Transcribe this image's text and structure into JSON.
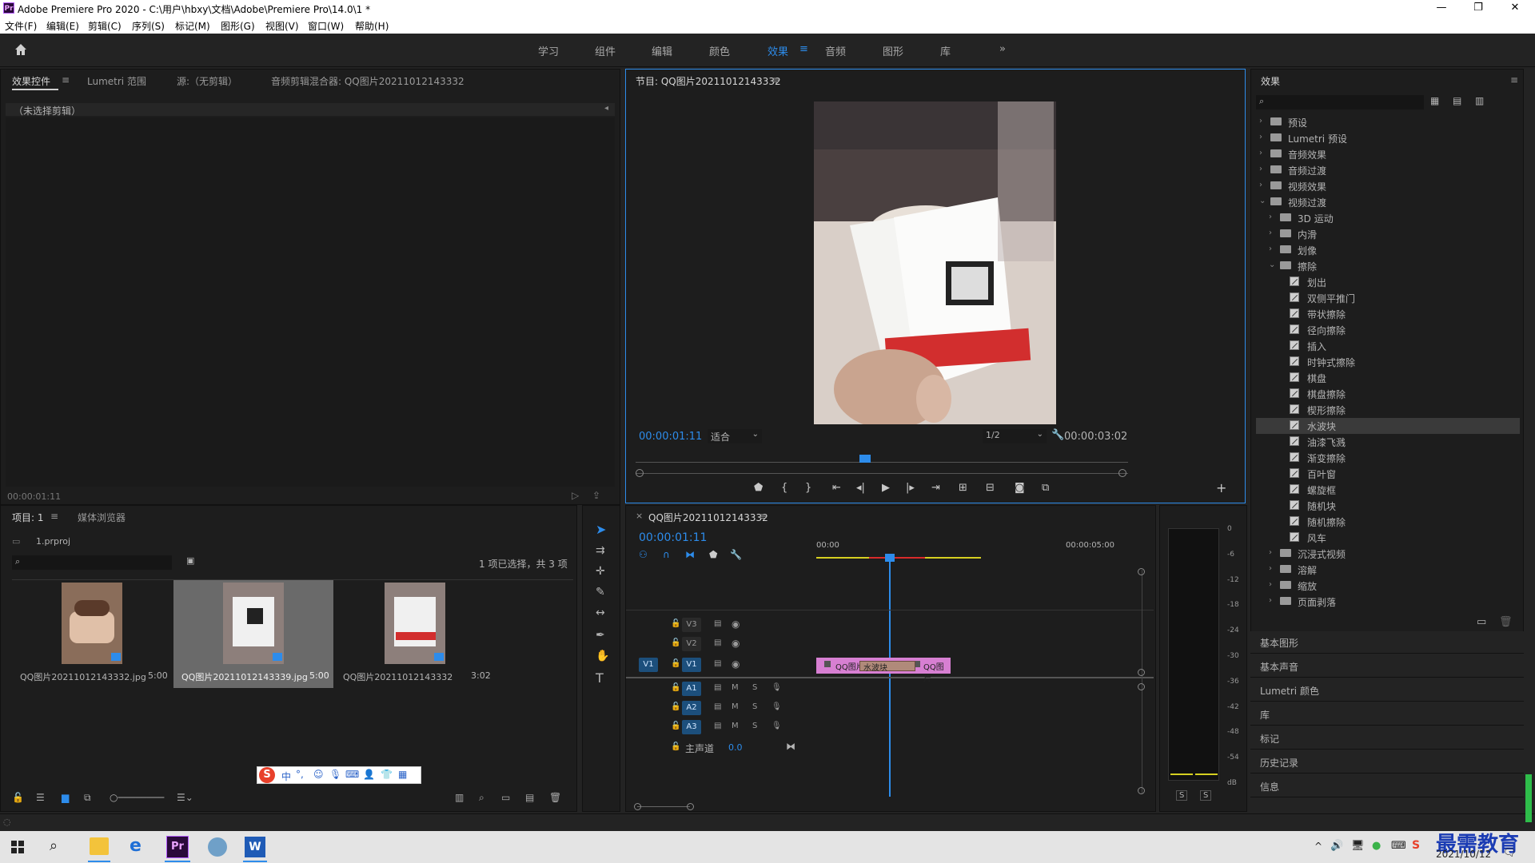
{
  "window": {
    "title": "Adobe Premiere Pro 2020 - C:\\用户\\hbxy\\文档\\Adobe\\Premiere Pro\\14.0\\1 *",
    "app_icon": "Pr"
  },
  "menu": [
    "文件(F)",
    "编辑(E)",
    "剪辑(C)",
    "序列(S)",
    "标记(M)",
    "图形(G)",
    "视图(V)",
    "窗口(W)",
    "帮助(H)"
  ],
  "workspaces": [
    "学习",
    "组件",
    "编辑",
    "颜色",
    "效果",
    "音频",
    "图形",
    "库"
  ],
  "workspace_active": "效果",
  "workspace_more": "»",
  "source_panel": {
    "tabs": [
      "效果控件",
      "Lumetri 范围",
      "源:（无剪辑）",
      "音频剪辑混合器: QQ图片20211012143332"
    ],
    "no_clip": "（未选择剪辑）",
    "timecode": "00:00:01:11"
  },
  "program_monitor": {
    "title": "节目: QQ图片20211012143332",
    "timecode": "00:00:01:11",
    "fit": "适合",
    "resolution": "1/2",
    "duration": "00:00:03:02",
    "playhead_fraction": 0.46
  },
  "effects_panel": {
    "title": "效果",
    "items": [
      {
        "label": "预设",
        "type": "folder",
        "level": 0,
        "expanded": false
      },
      {
        "label": "Lumetri 预设",
        "type": "folder",
        "level": 0,
        "expanded": false
      },
      {
        "label": "音频效果",
        "type": "folder",
        "level": 0,
        "expanded": false
      },
      {
        "label": "音频过渡",
        "type": "folder",
        "level": 0,
        "expanded": false
      },
      {
        "label": "视频效果",
        "type": "folder",
        "level": 0,
        "expanded": false
      },
      {
        "label": "视频过渡",
        "type": "folder",
        "level": 0,
        "expanded": true
      },
      {
        "label": "3D 运动",
        "type": "folder",
        "level": 1,
        "expanded": false
      },
      {
        "label": "内滑",
        "type": "folder",
        "level": 1,
        "expanded": false
      },
      {
        "label": "划像",
        "type": "folder",
        "level": 1,
        "expanded": false
      },
      {
        "label": "擦除",
        "type": "folder",
        "level": 1,
        "expanded": true
      },
      {
        "label": "划出",
        "type": "fx",
        "level": 2
      },
      {
        "label": "双侧平推门",
        "type": "fx",
        "level": 2
      },
      {
        "label": "带状擦除",
        "type": "fx",
        "level": 2
      },
      {
        "label": "径向擦除",
        "type": "fx",
        "level": 2
      },
      {
        "label": "插入",
        "type": "fx",
        "level": 2
      },
      {
        "label": "时钟式擦除",
        "type": "fx",
        "level": 2
      },
      {
        "label": "棋盘",
        "type": "fx",
        "level": 2
      },
      {
        "label": "棋盘擦除",
        "type": "fx",
        "level": 2
      },
      {
        "label": "楔形擦除",
        "type": "fx",
        "level": 2
      },
      {
        "label": "水波块",
        "type": "fx",
        "level": 2,
        "selected": true
      },
      {
        "label": "油漆飞溅",
        "type": "fx",
        "level": 2
      },
      {
        "label": "渐变擦除",
        "type": "fx",
        "level": 2
      },
      {
        "label": "百叶窗",
        "type": "fx",
        "level": 2
      },
      {
        "label": "螺旋框",
        "type": "fx",
        "level": 2
      },
      {
        "label": "随机块",
        "type": "fx",
        "level": 2
      },
      {
        "label": "随机擦除",
        "type": "fx",
        "level": 2
      },
      {
        "label": "风车",
        "type": "fx",
        "level": 2
      },
      {
        "label": "沉浸式视频",
        "type": "folder",
        "level": 1,
        "expanded": false
      },
      {
        "label": "溶解",
        "type": "folder",
        "level": 1,
        "expanded": false
      },
      {
        "label": "缩放",
        "type": "folder",
        "level": 1,
        "expanded": false
      },
      {
        "label": "页面剥落",
        "type": "folder",
        "level": 1,
        "expanded": false
      }
    ],
    "collapsed_panels": [
      "基本图形",
      "基本声音",
      "Lumetri 颜色",
      "库",
      "标记",
      "历史记录",
      "信息"
    ]
  },
  "project_panel": {
    "tabs": [
      "项目: 1",
      "媒体浏览器"
    ],
    "project_file": "1.prproj",
    "selection_info": "1 项已选择，共 3 项",
    "items": [
      {
        "name": "QQ图片20211012143332.jpg",
        "duration": "5:00",
        "selected": false
      },
      {
        "name": "QQ图片20211012143339.jpg",
        "duration": "5:00",
        "selected": true
      },
      {
        "name": "QQ图片20211012143332",
        "duration": "3:02",
        "selected": false
      }
    ]
  },
  "ime_toolbar": {
    "items": [
      "中",
      "°,"
    ]
  },
  "timeline": {
    "title": "QQ图片20211012143332",
    "timecode": "00:00:01:11",
    "ruler": [
      "00:00",
      "00:00:05:00"
    ],
    "video_tracks": [
      "V3",
      "V2",
      "V1"
    ],
    "audio_tracks": [
      "A1",
      "A2",
      "A3"
    ],
    "master": "主声道",
    "master_value": "0.0",
    "clip_left": "QQ图片",
    "clip_right": "QQ图片",
    "transition": "水波块"
  },
  "audio_meter": {
    "scale": [
      "0",
      "-6",
      "-12",
      "-18",
      "-24",
      "-30",
      "-36",
      "-42",
      "-48",
      "-54",
      "dB"
    ],
    "solo": [
      "S",
      "S"
    ]
  },
  "taskbar": {
    "time": "",
    "date": "2021/10/12",
    "watermark": "最需教育"
  },
  "colors": {
    "accent": "#2d8ceb",
    "clip": "#d77fd2",
    "transition": "#b08a7a"
  }
}
